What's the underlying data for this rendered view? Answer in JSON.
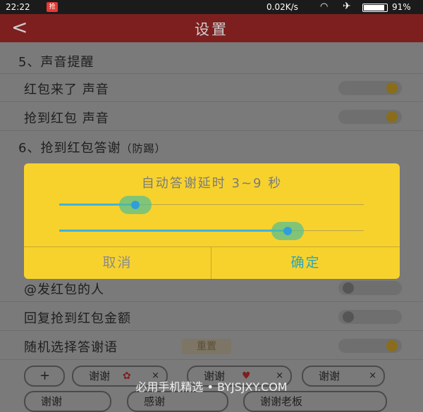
{
  "status_bar": {
    "time": "22:22",
    "badge": "抢",
    "net_speed": "0.02K/s",
    "battery_pct": "91%"
  },
  "titlebar": {
    "back": "<",
    "title": "设置"
  },
  "sections": {
    "sound": "5、声音提醒",
    "thanks": "6、抢到红包答谢",
    "thanks_note": "（防踢）"
  },
  "rows": {
    "hb_sound": "红包来了 声音",
    "grab_sound": "抢到红包 声音",
    "at_sender": "@发红包的人",
    "reply_amount": "回复抢到红包金额",
    "random_thanks": "随机选择答谢语",
    "reset": "重置"
  },
  "toggles": {
    "hb_sound": true,
    "grab_sound": true,
    "at_sender": false,
    "reply_amount": false,
    "random_thanks": true
  },
  "chips": {
    "add": "+",
    "c1": "谢谢",
    "c2": "谢谢",
    "c3": "谢谢",
    "c4": "谢谢",
    "c5": "感谢",
    "c6": "谢谢老板",
    "close": "×"
  },
  "dialog": {
    "title": "自动答谢延时  3~9 秒",
    "min_seconds": 3,
    "max_seconds": 9,
    "cancel": "取消",
    "confirm": "确定"
  },
  "watermark": "必用手机精选 • BYJSJXY.COM",
  "colors": {
    "accent": "#f7d22d",
    "titlebar": "#7e1f1f",
    "slider": "#3fb3dc"
  }
}
